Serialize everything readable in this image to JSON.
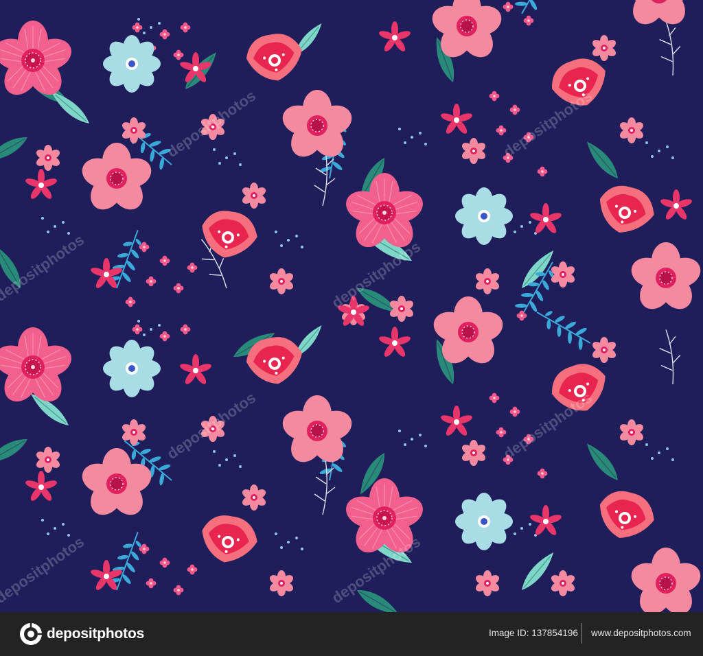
{
  "image": {
    "subject": "seamless-floral-pattern",
    "background_color": "#1f1d5a",
    "palette": {
      "pink_large": "#f2608e",
      "pink_light": "#f48a9f",
      "coral": "#f56f7f",
      "magenta_center": "#e0205f",
      "light_blue": "#a8dde6",
      "teal_leaf": "#2a8a7a",
      "dark_leaf": "#1f5a63",
      "mint": "#7fd6c8",
      "blue_fern": "#3aa8d8",
      "white_stem": "#dfe3ee"
    }
  },
  "watermark": {
    "text": "depositphotos"
  },
  "footer": {
    "brand": "depositphotos",
    "image_id": "Image ID: 137854196",
    "site": "www.depositphotos.com",
    "background_color": "#232323"
  }
}
